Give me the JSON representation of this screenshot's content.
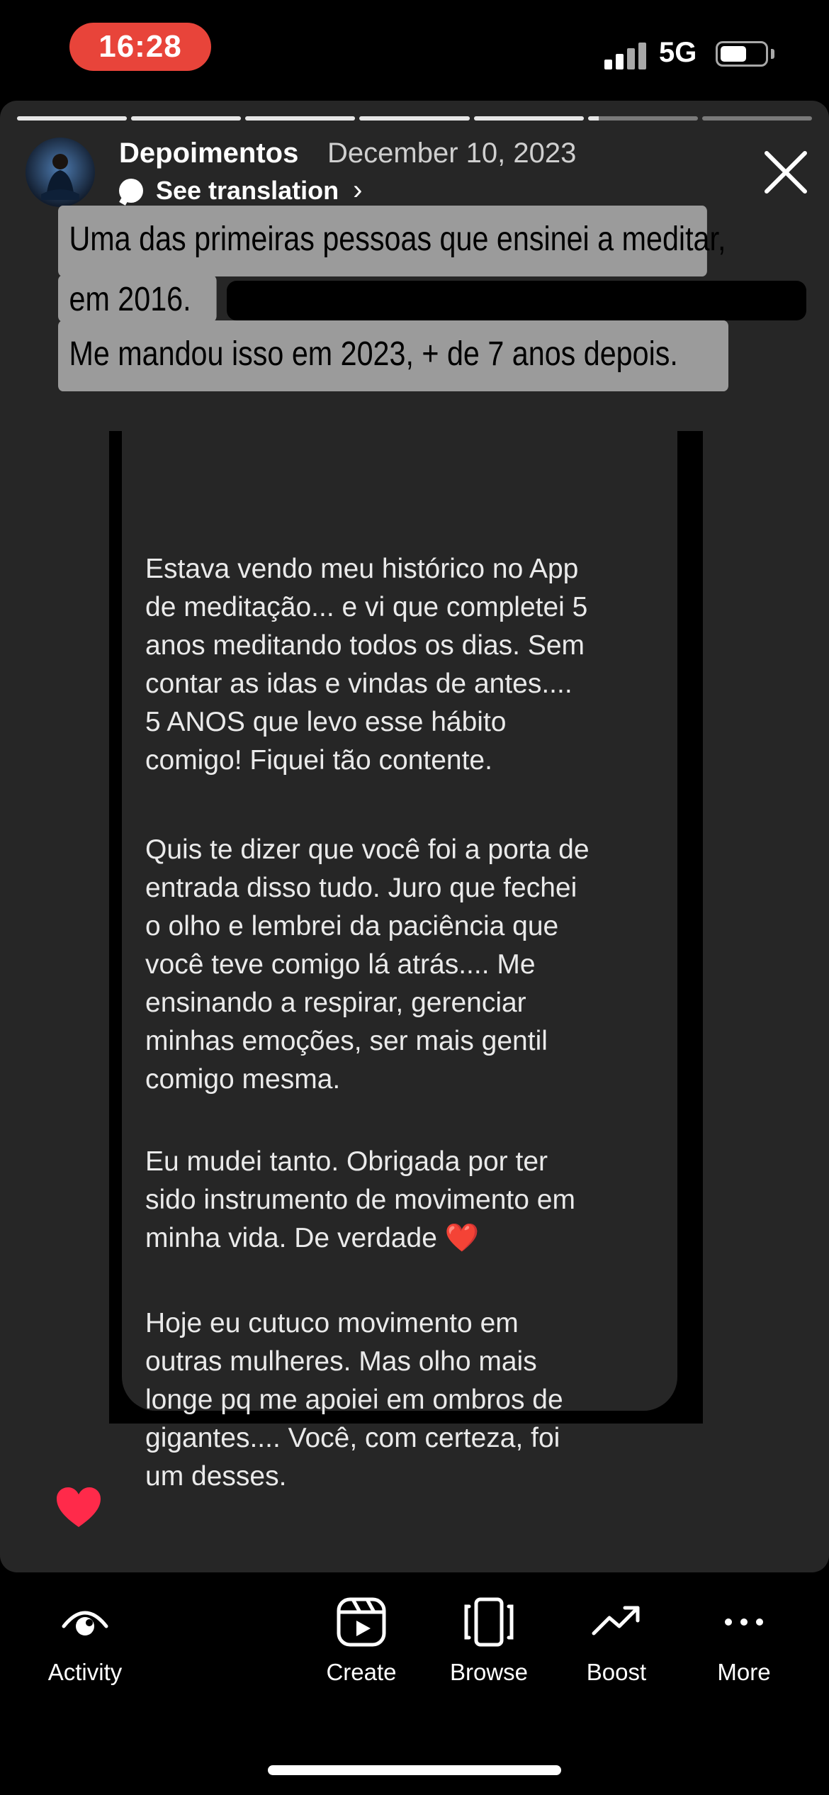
{
  "status_bar": {
    "time": "16:28",
    "network": "5G",
    "battery_level": 0.5,
    "icons": [
      "signal-icon",
      "battery-icon"
    ]
  },
  "story": {
    "progress": {
      "segments": 7,
      "completed": 5,
      "current_fill": 0.1
    },
    "account_name": "Depoimentos",
    "date": "December 10, 2023",
    "translation_label": "See translation",
    "caption": {
      "line1": "Uma das primeiras pessoas que ensinei a meditar,",
      "line2": "em 2016.",
      "line3": "Me mandou isso em 2023, + de 7 anos depois."
    },
    "message_paragraphs": [
      "Estava vendo meu histórico no App\nde meditação... e vi que completei 5\nanos meditando todos os dias. Sem\ncontar as idas e vindas de antes....\n5 ANOS que levo esse hábito\ncomigo! Fiquei tão contente.",
      "Quis te dizer que você foi a porta de\nentrada disso tudo. Juro que fechei\no olho e lembrei da paciência que\nvocê teve comigo lá atrás.... Me\nensinando a respirar, gerenciar\nminhas emoções, ser mais gentil\ncomigo mesma.",
      "Eu mudei tanto. Obrigada por ter\nsido instrumento de movimento em\nminha vida. De verdade ❤️",
      "Hoje eu cutuco movimento em\noutras mulheres. Mas olho mais\nlonge pq me apoiei em ombros de\ngigantes.... Você, com certeza, foi\num desses."
    ]
  },
  "toolbar": {
    "items": [
      {
        "label": "Activity",
        "icon": "eye-icon"
      },
      {
        "label": "Create",
        "icon": "reels-icon"
      },
      {
        "label": "Browse",
        "icon": "carousel-icon"
      },
      {
        "label": "Boost",
        "icon": "trend-icon"
      },
      {
        "label": "More",
        "icon": "more-icon"
      }
    ]
  },
  "colors": {
    "time_pill": "#e8443a",
    "story_bg": "#262626",
    "caption_bg": "#9b9b9b",
    "heart": "#ff2a4a"
  }
}
